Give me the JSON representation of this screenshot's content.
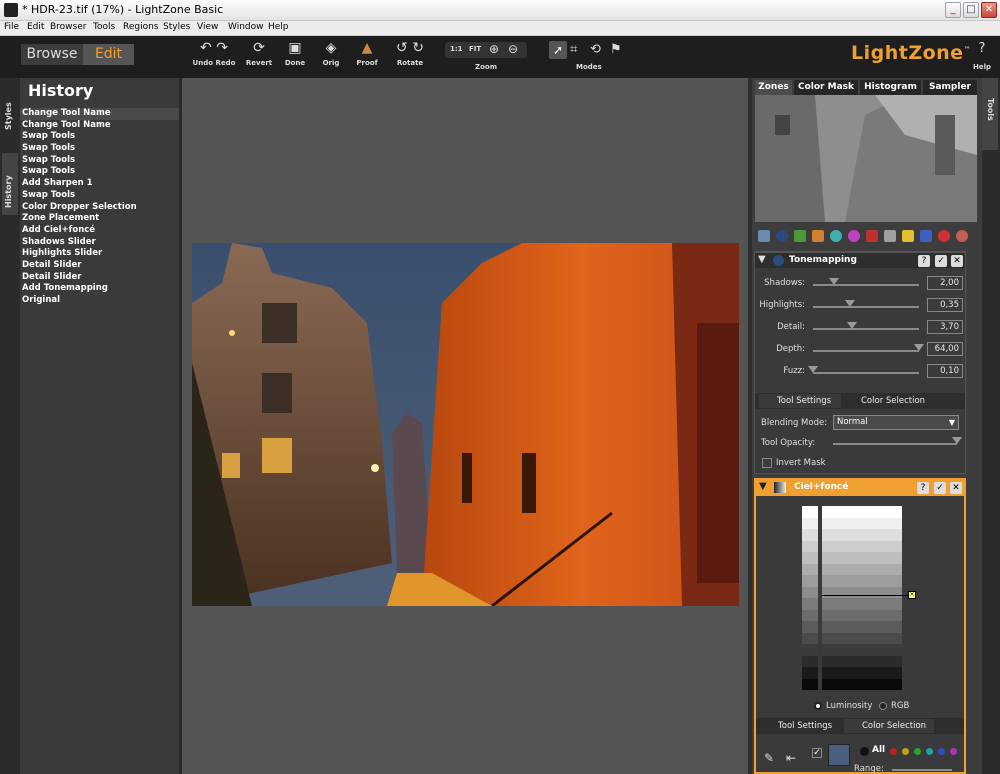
{
  "window": {
    "title": "* HDR-23.tif (17%) - LightZone Basic",
    "min": "_",
    "max": "□",
    "close": "✕"
  },
  "menu": [
    "File",
    "Edit",
    "Browser",
    "Tools",
    "Regions",
    "Styles",
    "View",
    "Window",
    "Help"
  ],
  "mode_tabs": {
    "browse": "Browse",
    "edit": "Edit"
  },
  "toolbar": {
    "undo_redo": "Undo Redo",
    "revert": "Revert",
    "done": "Done",
    "orig": "Orig",
    "proof": "Proof",
    "rotate": "Rotate",
    "zoom": {
      "label": "Zoom",
      "one_to_one": "1:1",
      "fit": "FIT"
    },
    "modes": "Modes",
    "help": "Help"
  },
  "logo": {
    "name": "LightZone",
    "tm": "™"
  },
  "side_tabs": {
    "styles": "Styles",
    "history": "History",
    "tools": "Tools"
  },
  "history": {
    "title": "History",
    "items": [
      "Change Tool Name",
      "Change Tool Name",
      "Swap Tools",
      "Swap Tools",
      "Swap Tools",
      "Swap Tools",
      "Add Sharpen 1",
      "Swap Tools",
      "Color Dropper Selection",
      "Zone Placement",
      "Add Ciel+foncé",
      "Shadows Slider",
      "Highlights Slider",
      "Detail Slider",
      "Detail Slider",
      "Add Tonemapping",
      "Original"
    ]
  },
  "inspector_tabs": [
    "Zones",
    "Color Mask",
    "Histogram",
    "Sampler"
  ],
  "tonemapping": {
    "title": "Tonemapping",
    "sliders": [
      {
        "label": "Shadows:",
        "value": "2,00",
        "pos": 0.2
      },
      {
        "label": "Highlights:",
        "value": "0,35",
        "pos": 0.35
      },
      {
        "label": "Detail:",
        "value": "3,70",
        "pos": 0.37
      },
      {
        "label": "Depth:",
        "value": "64,00",
        "pos": 1.0
      },
      {
        "label": "Fuzz:",
        "value": "0,10",
        "pos": 0.0
      }
    ],
    "tabs": {
      "settings": "Tool Settings",
      "selection": "Color Selection"
    },
    "blending_label": "Blending Mode:",
    "blending_value": "Normal",
    "opacity_label": "Tool Opacity:",
    "opacity": 1.0,
    "invert_label": "Invert Mask"
  },
  "ciel": {
    "title": "Ciel+foncé",
    "radio_luminosity": "Luminosity",
    "radio_rgb": "RGB",
    "tabs": {
      "settings": "Tool Settings",
      "selection": "Color Selection"
    },
    "all_label": "All",
    "range_label": "Range:"
  },
  "colors": {
    "accent": "#f0a030",
    "panel": "#3a3a3a",
    "canvas": "#545454"
  }
}
